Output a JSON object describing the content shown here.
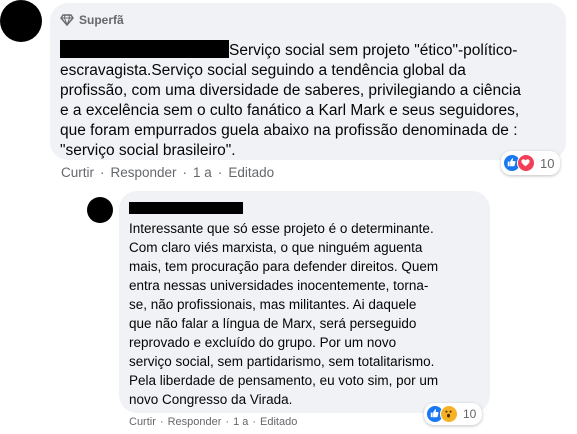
{
  "colors": {
    "bubble_bg": "#f0f2f5",
    "meta_text": "#65676b",
    "like_blue": "#1877f2",
    "love_red": "#f33e58",
    "wow_yellow": "#f7b125"
  },
  "main_comment": {
    "badge_icon": "diamond-badge-icon",
    "badge_label": "Superfã",
    "author_redacted": true,
    "text": "Serviço social sem projeto \"ético\"-político-\nescravagista.Serviço social seguindo a tendência global da\nprofissão, com uma diversidade de saberes, privilegiando a ciência\ne a excelência sem o culto fanático a Karl Mark e seus seguidores,\nque foram empurrados guela abaixo na profissão denominada de :\n\"serviço social brasileiro\".",
    "actions": {
      "like": "Curtir",
      "reply": "Responder",
      "time": "1 a",
      "edited": "Editado"
    },
    "reactions": {
      "icons": [
        "like-icon",
        "love-icon"
      ],
      "count": "10"
    }
  },
  "reply_comment": {
    "author_redacted": true,
    "text": "Interessante que só esse projeto é o determinante.\nCom claro viés marxista, o que ninguém aguenta\nmais, tem procuração para defender direitos. Quem\nentra nessas universidades inocentemente, torna-\nse, não profissionais, mas militantes. Ai daquele\nque não falar a língua de Marx, será perseguido\nreprovado e excluído do grupo. Por um novo\nserviço social, sem partidarismo, sem totalitarismo.\nPela liberdade de pensamento, eu voto sim, por um\nnovo Congresso da Virada.",
    "actions": {
      "like": "Curtir",
      "reply": "Responder",
      "time": "1 a",
      "edited": "Editado"
    },
    "reactions": {
      "icons": [
        "like-icon",
        "wow-icon"
      ],
      "count": "10"
    }
  }
}
